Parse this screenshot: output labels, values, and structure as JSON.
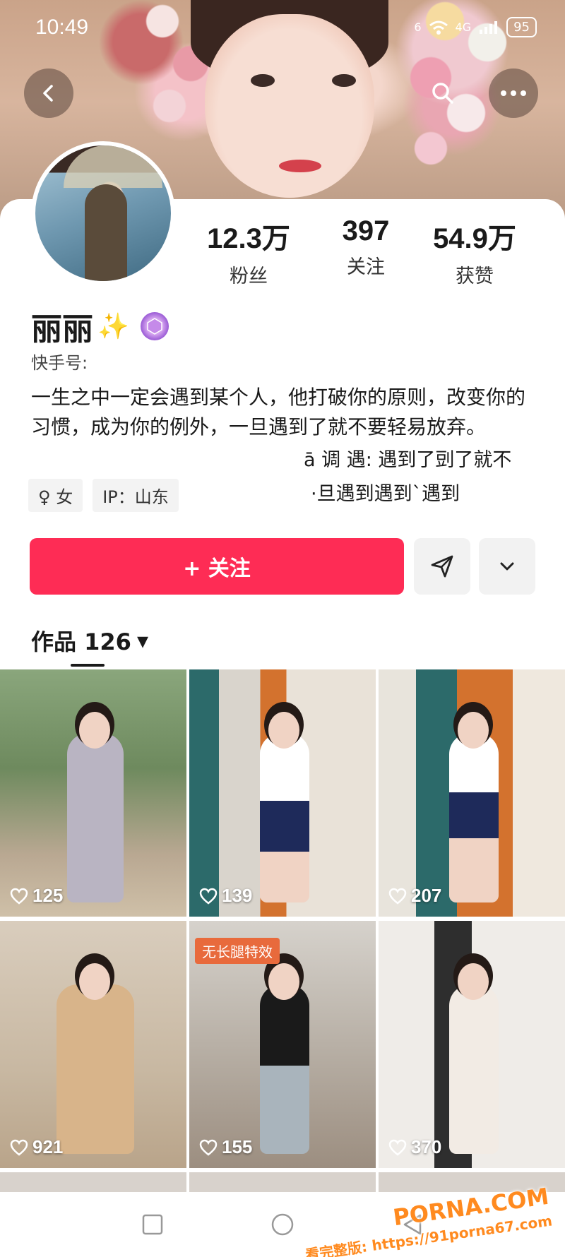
{
  "status": {
    "time": "10:49",
    "signal": "6",
    "network": "4G",
    "battery": "95"
  },
  "stats": [
    {
      "value": "12.3万",
      "label": "粉丝"
    },
    {
      "value": "397",
      "label": "关注"
    },
    {
      "value": "54.9万",
      "label": "获赞"
    }
  ],
  "profile": {
    "nickname": "丽丽",
    "sparkle": "✨",
    "kuaishou_id_label": "快手号:",
    "bio": "一生之中一定会遇到某个人，他打破你的原则，改变你的习惯，成为你的例外，一旦遇到了就不要轻易放弃。",
    "overlay_line1": "ā 调 遇: 遇到了剅了就不",
    "overlay_line2": "·旦遇到遇到`遇到",
    "tags": [
      "♀ 女",
      "IP：山东"
    ]
  },
  "actions": {
    "follow_label": "+ 关注"
  },
  "works": {
    "label": "作品 126",
    "caret": "▾"
  },
  "videos": [
    {
      "likes": "125"
    },
    {
      "likes": "139"
    },
    {
      "likes": "207"
    },
    {
      "likes": "921"
    },
    {
      "likes": "155",
      "ribbon": "无长腿特效"
    },
    {
      "likes": "370"
    }
  ],
  "watermark": {
    "brand": "PORNA.COM",
    "url": "看完整版: https://91porna67.com"
  },
  "colors": {
    "accent": "#fe2c55",
    "watermark": "#ff8a1f"
  }
}
